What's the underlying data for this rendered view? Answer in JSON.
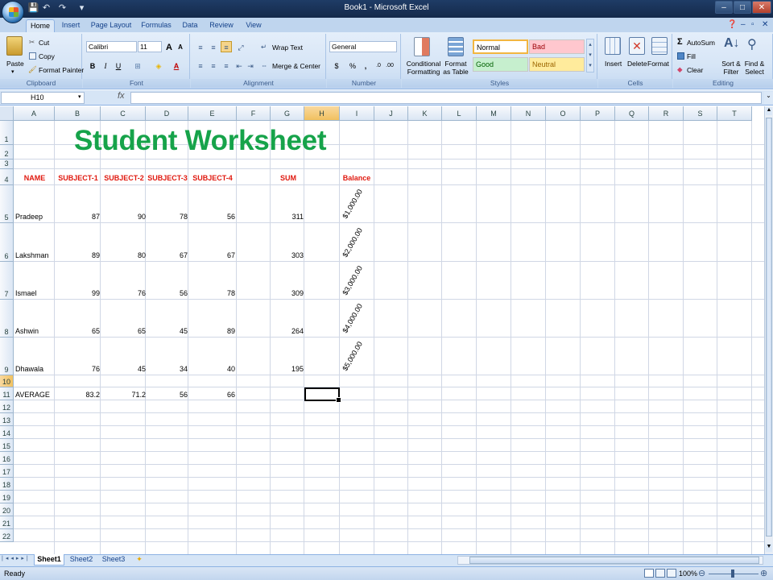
{
  "window": {
    "title": "Book1 - Microsoft Excel"
  },
  "quick_access": {
    "save": "💾",
    "undo": "↶",
    "redo": "↷",
    "more": "▾"
  },
  "ribbon": {
    "tabs": [
      "Home",
      "Insert",
      "Page Layout",
      "Formulas",
      "Data",
      "Review",
      "View"
    ],
    "clipboard": {
      "paste": "Paste",
      "cut": "Cut",
      "copy": "Copy",
      "format_painter": "Format Painter",
      "label": "Clipboard"
    },
    "font": {
      "name": "Calibri",
      "size": "11",
      "grow": "A",
      "shrink": "A",
      "bold": "B",
      "italic": "I",
      "underline": "U",
      "label": "Font"
    },
    "alignment": {
      "wrap_text": "Wrap Text",
      "merge_center": "Merge & Center",
      "label": "Alignment"
    },
    "number": {
      "format": "General",
      "currency": "$",
      "percent": "%",
      "comma": ",",
      "label": "Number"
    },
    "styles": {
      "conditional_formatting": "Conditional Formatting",
      "format_as_table": "Format as Table",
      "normal": "Normal",
      "bad": "Bad",
      "good": "Good",
      "neutral": "Neutral",
      "label": "Styles"
    },
    "cells": {
      "insert": "Insert",
      "delete": "Delete",
      "format": "Format",
      "label": "Cells"
    },
    "editing": {
      "autosum": "AutoSum",
      "fill": "Fill",
      "clear": "Clear",
      "sort_filter": "Sort & Filter",
      "find_select": "Find & Select",
      "label": "Editing"
    }
  },
  "formula_bar": {
    "name_box": "H10",
    "fx": "fx",
    "formula": ""
  },
  "sheet": {
    "columns": [
      "A",
      "B",
      "C",
      "D",
      "E",
      "F",
      "G",
      "H",
      "I",
      "J",
      "K",
      "L",
      "M",
      "N",
      "O",
      "P",
      "Q",
      "R",
      "S",
      "T"
    ],
    "active_column": "H",
    "row_numbers": [
      "1",
      "2",
      "3",
      "4",
      "5",
      "6",
      "7",
      "8",
      "9",
      "10",
      "11",
      "12",
      "13",
      "14",
      "15",
      "16",
      "17",
      "18",
      "19",
      "20",
      "21",
      "22"
    ],
    "active_row": "10",
    "title": "Student Worksheet",
    "headers": {
      "name": "NAME",
      "s1": "SUBJECT-1",
      "s2": "SUBJECT-2",
      "s3": "SUBJECT-3",
      "s4": "SUBJECT-4",
      "sum": "SUM",
      "balance": "Balance"
    },
    "students": [
      {
        "name": "Pradeep",
        "s1": "87",
        "s2": "90",
        "s3": "78",
        "s4": "56",
        "sum": "311",
        "balance": "$1,000.00"
      },
      {
        "name": "Lakshman",
        "s1": "89",
        "s2": "80",
        "s3": "67",
        "s4": "67",
        "sum": "303",
        "balance": "$2,000.00"
      },
      {
        "name": "Ismael",
        "s1": "99",
        "s2": "76",
        "s3": "56",
        "s4": "78",
        "sum": "309",
        "balance": "$3,000.00"
      },
      {
        "name": "Ashwin",
        "s1": "65",
        "s2": "65",
        "s3": "45",
        "s4": "89",
        "sum": "264",
        "balance": "$4,000.00"
      },
      {
        "name": "Dhawala",
        "s1": "76",
        "s2": "45",
        "s3": "34",
        "s4": "40",
        "sum": "195",
        "balance": "$5,000.00"
      }
    ],
    "average": {
      "label": "AVERAGE",
      "s1": "83.2",
      "s2": "71.2",
      "s3": "56",
      "s4": "66"
    },
    "selected_cell": "H10"
  },
  "sheet_tabs": [
    "Sheet1",
    "Sheet2",
    "Sheet3"
  ],
  "status": {
    "text": "Ready",
    "zoom": "100%"
  },
  "colors": {
    "title_green": "#16a34a",
    "header_red": "#e0190f",
    "ribbon_blue": "#d6e5f6"
  }
}
